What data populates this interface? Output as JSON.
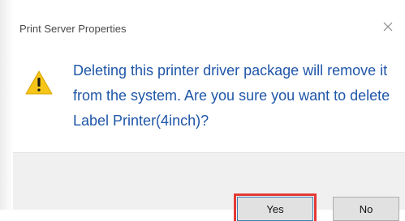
{
  "window": {
    "title": "Print Server Properties",
    "close_icon": "close-icon"
  },
  "message": {
    "icon": "warning-icon",
    "text": "Deleting this printer driver package will remove it from the system. Are you sure you want to delete Label Printer(4inch)?"
  },
  "buttons": {
    "yes_label": "Yes",
    "no_label": "No"
  },
  "colors": {
    "message_text": "#1f56a8",
    "warning_fill": "#f5c518",
    "highlight_outline": "#e53935"
  }
}
